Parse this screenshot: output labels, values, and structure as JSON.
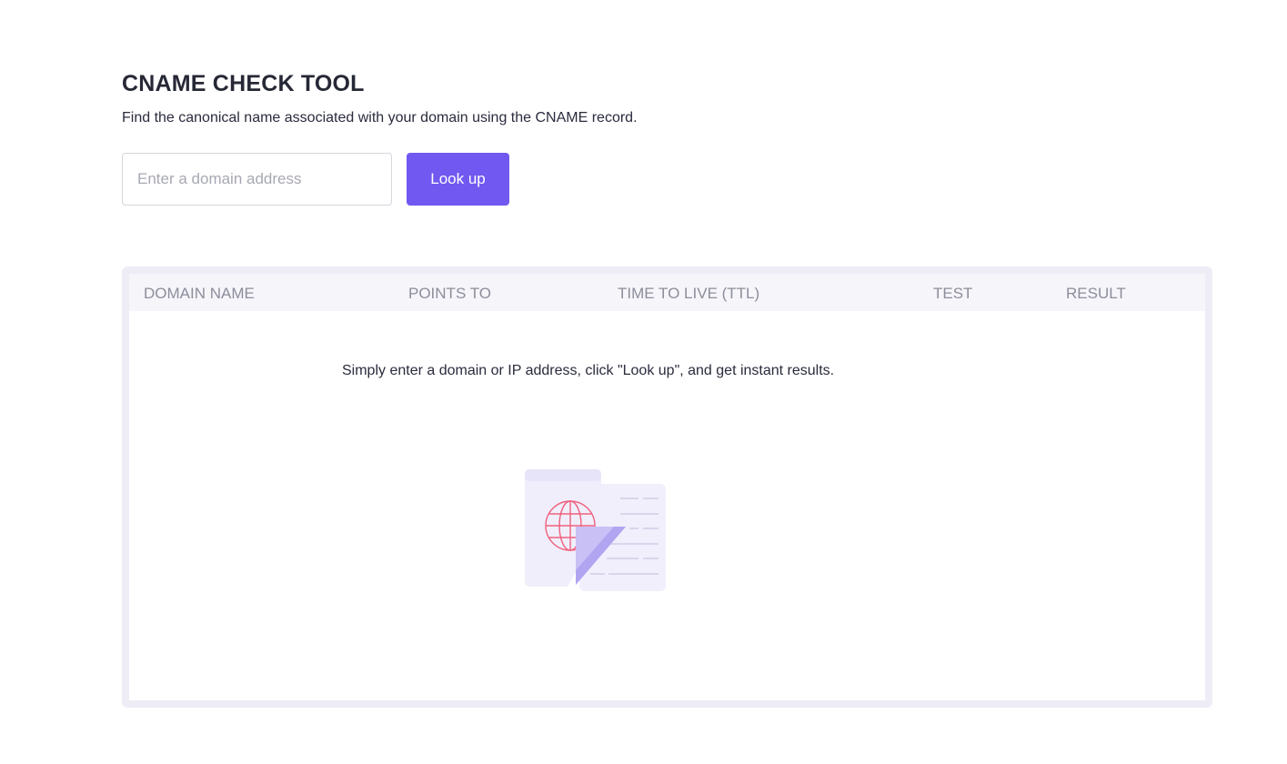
{
  "tool": {
    "title": "CNAME CHECK TOOL",
    "subtitle": "Find the canonical name associated with your domain using the CNAME record."
  },
  "search": {
    "placeholder": "Enter a domain address",
    "value": "",
    "button_label": "Look up"
  },
  "results": {
    "columns": [
      "DOMAIN NAME",
      "POINTS TO",
      "TIME TO LIVE (TTL)",
      "TEST",
      "RESULT"
    ],
    "empty_message": "Simply enter a domain or IP address, click \"Look up\", and get instant results.",
    "illustration_icon": "globe-document-icon"
  },
  "colors": {
    "accent": "#7158f0",
    "frame": "#eeedf6",
    "header_bg": "#f5f5fa",
    "globe": "#f0607e"
  }
}
